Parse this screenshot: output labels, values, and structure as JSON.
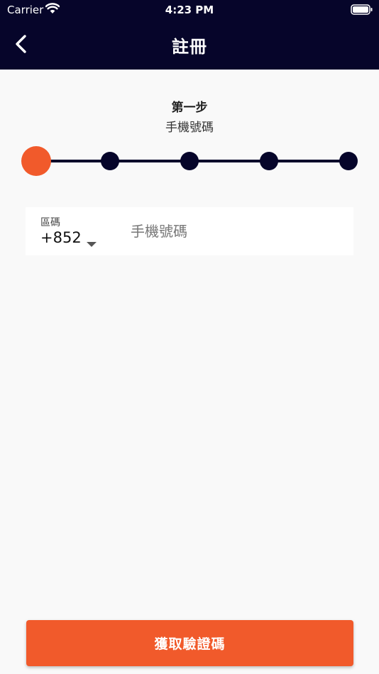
{
  "status_bar": {
    "carrier": "Carrier",
    "time": "4:23 PM",
    "wifi_icon": "wifi-icon",
    "battery_icon": "battery-icon"
  },
  "nav": {
    "title": "註冊",
    "back_icon": "chevron-left-icon"
  },
  "step": {
    "title": "第一步",
    "subtitle": "手機號碼",
    "current_step": 1,
    "total_steps": 5
  },
  "phone_form": {
    "area_code_label": "區碼",
    "area_code_value": "+852",
    "phone_placeholder": "手機號碼",
    "phone_value": ""
  },
  "submit_button": {
    "label": "獲取驗證碼"
  },
  "colors": {
    "nav_background": "#06052a",
    "accent": "#f15a2b",
    "page_background": "#f9f9f9"
  }
}
